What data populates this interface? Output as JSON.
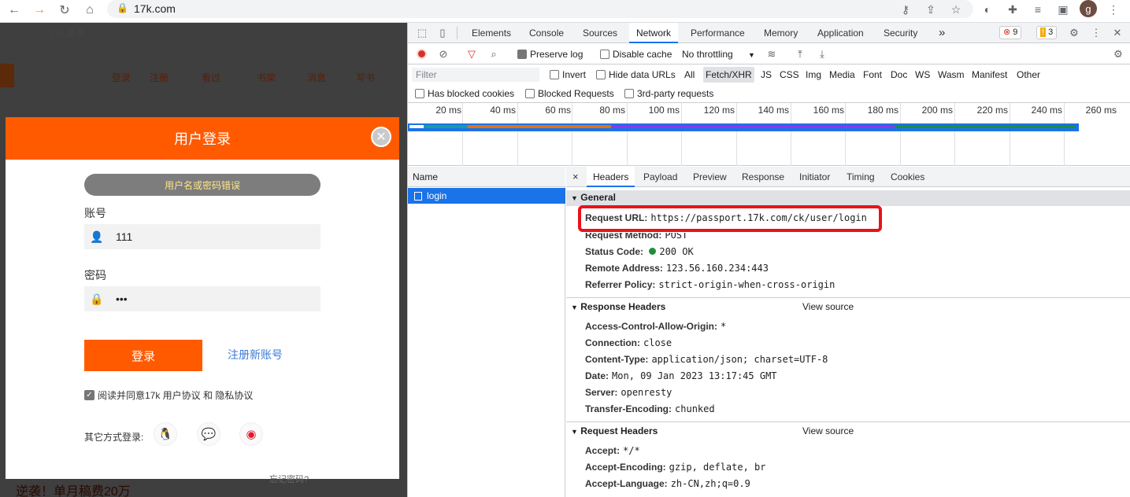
{
  "browser": {
    "url": "17k.com",
    "avatar_letter": "g"
  },
  "page": {
    "header_text": "17K漫画",
    "nav": [
      "登录",
      "注册",
      "看过",
      "书架",
      "消息",
      "写书"
    ],
    "bottom_text": "逆袭！单月稿费20万",
    "bottom_right": "忘记密码?"
  },
  "modal": {
    "title": "用户登录",
    "error": "用户名或密码错误",
    "account_label": "账号",
    "account_value": "111",
    "password_label": "密码",
    "password_value": "•••",
    "login_button": "登录",
    "register_link": "注册新账号",
    "agree_text": "阅读并同意17k 用户协议 和 隐私协议",
    "other_login": "其它方式登录:"
  },
  "devtools": {
    "tabs": [
      "Elements",
      "Console",
      "Sources",
      "Network",
      "Performance",
      "Memory",
      "Application",
      "Security"
    ],
    "active_tab": "Network",
    "more": "»",
    "error_count": "9",
    "warning_count": "3",
    "toolbar": {
      "preserve_log": "Preserve log",
      "disable_cache": "Disable cache",
      "throttling": "No throttling"
    },
    "filter": {
      "placeholder": "Filter",
      "invert": "Invert",
      "hide_data_urls": "Hide data URLs",
      "types": [
        "All",
        "Fetch/XHR",
        "JS",
        "CSS",
        "Img",
        "Media",
        "Font",
        "Doc",
        "WS",
        "Wasm",
        "Manifest",
        "Other"
      ],
      "active_type": "Fetch/XHR",
      "has_blocked_cookies": "Has blocked cookies",
      "blocked_requests": "Blocked Requests",
      "third_party": "3rd-party requests"
    },
    "timeline_ticks": [
      "20 ms",
      "40 ms",
      "60 ms",
      "80 ms",
      "100 ms",
      "120 ms",
      "140 ms",
      "160 ms",
      "180 ms",
      "200 ms",
      "220 ms",
      "240 ms",
      "260 ms"
    ],
    "name_header": "Name",
    "request_name": "login",
    "detail_tabs": [
      "Headers",
      "Payload",
      "Preview",
      "Response",
      "Initiator",
      "Timing",
      "Cookies"
    ],
    "active_detail_tab": "Headers",
    "general": {
      "title": "General",
      "request_url_key": "Request URL:",
      "request_url": "https://passport.17k.com/ck/user/login",
      "request_method_key": "Request Method:",
      "request_method": "POST",
      "status_code_key": "Status Code:",
      "status_code": "200 OK",
      "remote_address_key": "Remote Address:",
      "remote_address": "123.56.160.234:443",
      "referrer_policy_key": "Referrer Policy:",
      "referrer_policy": "strict-origin-when-cross-origin"
    },
    "response_headers": {
      "title": "Response Headers",
      "view_source": "View source",
      "items": [
        {
          "k": "Access-Control-Allow-Origin:",
          "v": "*"
        },
        {
          "k": "Connection:",
          "v": "close"
        },
        {
          "k": "Content-Type:",
          "v": "application/json; charset=UTF-8"
        },
        {
          "k": "Date:",
          "v": "Mon, 09 Jan 2023 13:17:45 GMT"
        },
        {
          "k": "Server:",
          "v": "openresty"
        },
        {
          "k": "Transfer-Encoding:",
          "v": "chunked"
        }
      ]
    },
    "request_headers": {
      "title": "Request Headers",
      "view_source": "View source",
      "items": [
        {
          "k": "Accept:",
          "v": "*/*"
        },
        {
          "k": "Accept-Encoding:",
          "v": "gzip, deflate, br"
        },
        {
          "k": "Accept-Language:",
          "v": "zh-CN,zh;q=0.9"
        }
      ]
    },
    "colors": {
      "accent": "#1a73e8",
      "highlight": "#e8131a",
      "brand": "#ff5a00"
    }
  }
}
